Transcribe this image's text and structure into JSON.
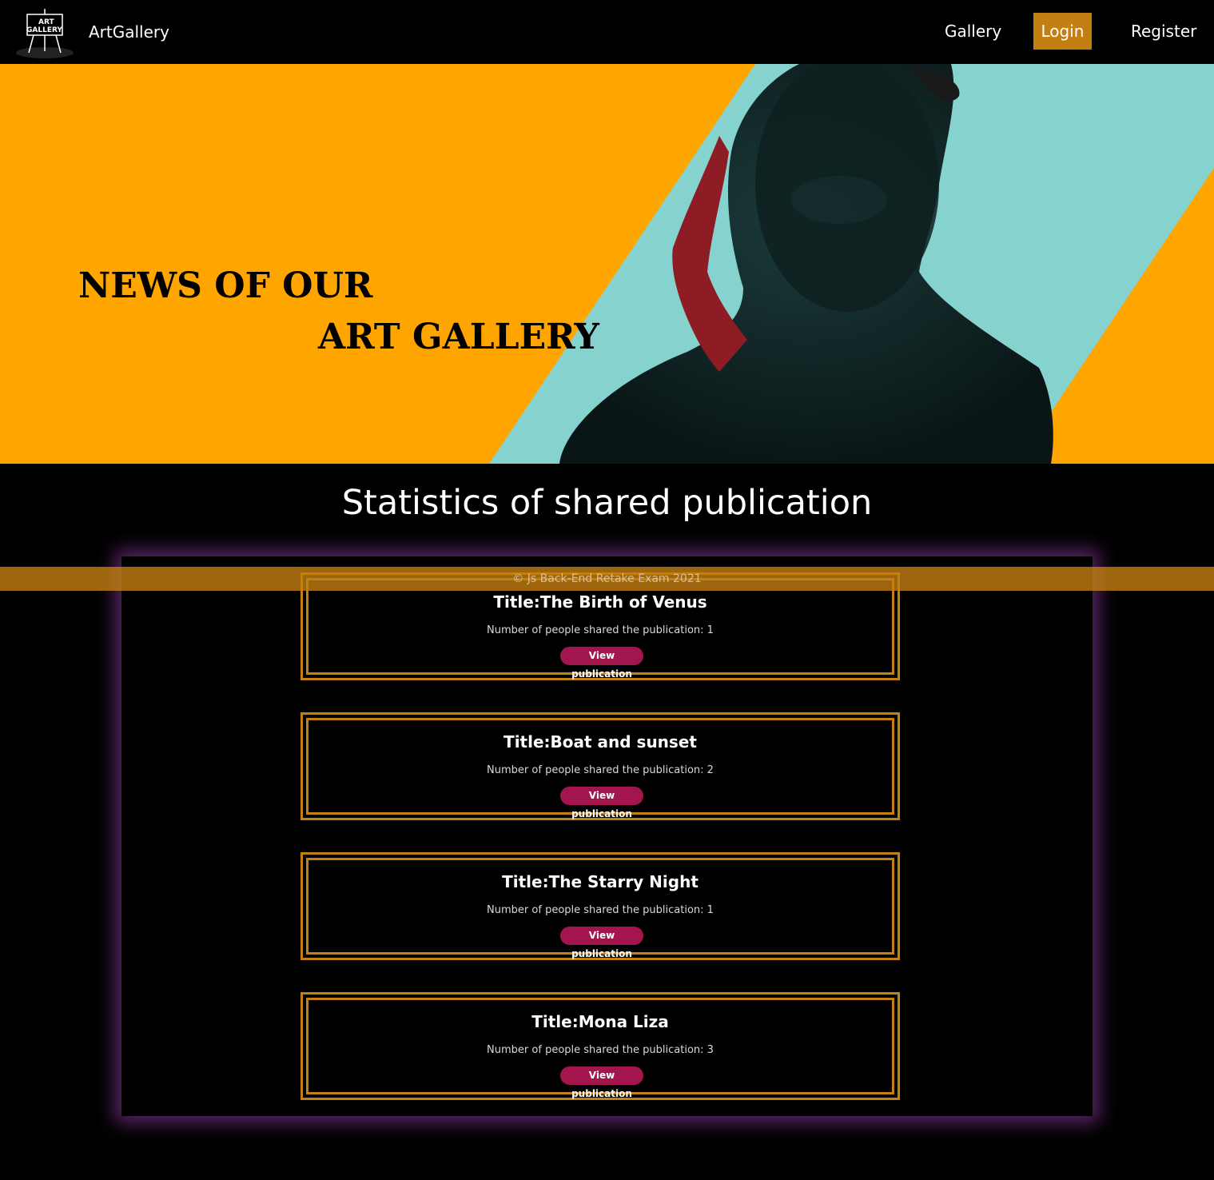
{
  "nav": {
    "brand": "ArtGallery",
    "logo_text_top": "ART",
    "logo_text_bottom": "GALLERY",
    "links": [
      {
        "label": "Gallery",
        "active": false
      },
      {
        "label": "Login",
        "active": true
      },
      {
        "label": "Register",
        "active": false
      }
    ]
  },
  "hero": {
    "line1": "NEWS OF OUR",
    "line2": "ART GALLERY"
  },
  "statistics": {
    "title": "Statistics of shared publication",
    "button_label": "View publication",
    "count_prefix": "Number of people shared the publication: ",
    "publications": [
      {
        "title": "Title:The Birth of Venus",
        "shares": "1"
      },
      {
        "title": "Title:Boat and sunset",
        "shares": "2"
      },
      {
        "title": "Title:The Starry Night",
        "shares": "1"
      },
      {
        "title": "Title:Mona Liza",
        "shares": "3"
      }
    ]
  },
  "footer": {
    "text": "© Js Back-End Retake Exam 2021"
  },
  "colors": {
    "accent": "#c47f12",
    "hero_bg": "#ffa500",
    "hero_teal": "#86d2cf",
    "button": "#a3164d",
    "panel_glow": "#aa46be"
  }
}
